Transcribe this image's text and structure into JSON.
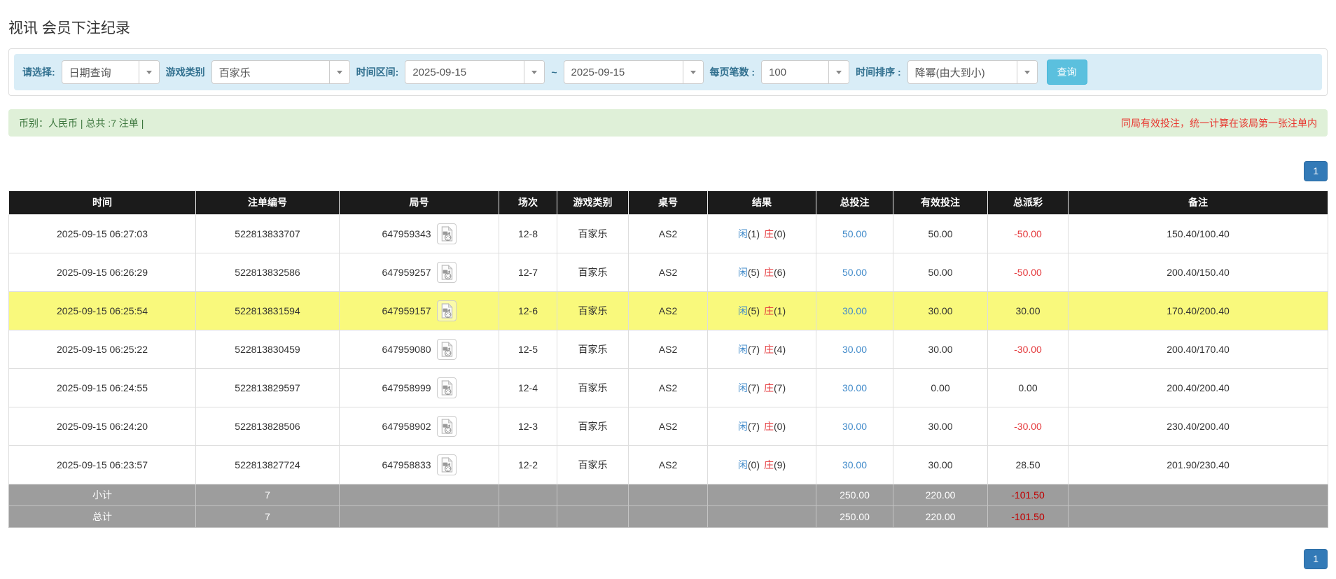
{
  "page": {
    "title": "视讯 会员下注纪录"
  },
  "colors": {
    "filter_bar_bg": "#d9edf7",
    "filter_label_blue": "#31708f",
    "summary_bg": "#dff0d8",
    "summary_green": "#3c763d",
    "notice_red": "#e8352e",
    "link_blue": "#428bca",
    "player_blue": "#428bca",
    "banker_red": "#e4393c",
    "negative_red": "#e4393c",
    "highlight_yellow": "#f9f97c",
    "table_header_bg": "#1b1b1b",
    "subtotal_bg": "#9d9d9d",
    "search_button_bg": "#5bc0de",
    "pagination_bg": "#337ab7"
  },
  "filters": {
    "mode_label": "请选择:",
    "mode_value": "日期查询",
    "game_label": "游戏类别",
    "game_value": "百家乐",
    "range_label": "时间区间:",
    "range_from": "2025-09-15",
    "range_separator": "~",
    "range_to": "2025-09-15",
    "per_page_label": "每页笔数 :",
    "per_page_value": "100",
    "sort_label": "时间排序 :",
    "sort_value": "降幂(由大到小)",
    "search_button": "查询"
  },
  "summary": {
    "left": "币别：人民币 | 总共 :7 注单 |",
    "right": "同局有效投注，统一计算在该局第一张注单内"
  },
  "pagination": {
    "page": "1"
  },
  "table": {
    "headers": [
      "时间",
      "注单编号",
      "局号",
      "场次",
      "游戏类别",
      "桌号",
      "结果",
      "总投注",
      "有效投注",
      "总派彩",
      "备注"
    ],
    "result_labels": {
      "player": "闲",
      "banker": "庄"
    },
    "rows": [
      {
        "time": "2025-09-15 06:27:03",
        "bet_id": "522813833707",
        "round_id": "647959343",
        "session": "12-8",
        "game": "百家乐",
        "table_id": "AS2",
        "player": "1",
        "banker": "0",
        "total_bet": "50.00",
        "valid_bet": "50.00",
        "payout": "-50.00",
        "remark": "150.40/100.40",
        "highlighted": false
      },
      {
        "time": "2025-09-15 06:26:29",
        "bet_id": "522813832586",
        "round_id": "647959257",
        "session": "12-7",
        "game": "百家乐",
        "table_id": "AS2",
        "player": "5",
        "banker": "6",
        "total_bet": "50.00",
        "valid_bet": "50.00",
        "payout": "-50.00",
        "remark": "200.40/150.40",
        "highlighted": false
      },
      {
        "time": "2025-09-15 06:25:54",
        "bet_id": "522813831594",
        "round_id": "647959157",
        "session": "12-6",
        "game": "百家乐",
        "table_id": "AS2",
        "player": "5",
        "banker": "1",
        "total_bet": "30.00",
        "valid_bet": "30.00",
        "payout": "30.00",
        "remark": "170.40/200.40",
        "highlighted": true
      },
      {
        "time": "2025-09-15 06:25:22",
        "bet_id": "522813830459",
        "round_id": "647959080",
        "session": "12-5",
        "game": "百家乐",
        "table_id": "AS2",
        "player": "7",
        "banker": "4",
        "total_bet": "30.00",
        "valid_bet": "30.00",
        "payout": "-30.00",
        "remark": "200.40/170.40",
        "highlighted": false
      },
      {
        "time": "2025-09-15 06:24:55",
        "bet_id": "522813829597",
        "round_id": "647958999",
        "session": "12-4",
        "game": "百家乐",
        "table_id": "AS2",
        "player": "7",
        "banker": "7",
        "total_bet": "30.00",
        "valid_bet": "0.00",
        "payout": "0.00",
        "remark": "200.40/200.40",
        "highlighted": false
      },
      {
        "time": "2025-09-15 06:24:20",
        "bet_id": "522813828506",
        "round_id": "647958902",
        "session": "12-3",
        "game": "百家乐",
        "table_id": "AS2",
        "player": "7",
        "banker": "0",
        "total_bet": "30.00",
        "valid_bet": "30.00",
        "payout": "-30.00",
        "remark": "230.40/200.40",
        "highlighted": false
      },
      {
        "time": "2025-09-15 06:23:57",
        "bet_id": "522813827724",
        "round_id": "647958833",
        "session": "12-2",
        "game": "百家乐",
        "table_id": "AS2",
        "player": "0",
        "banker": "9",
        "total_bet": "30.00",
        "valid_bet": "30.00",
        "payout": "28.50",
        "remark": "201.90/230.40",
        "highlighted": false
      }
    ],
    "subtotal": {
      "label": "小计",
      "count": "7",
      "total_bet": "250.00",
      "valid_bet": "220.00",
      "payout": "-101.50"
    },
    "total": {
      "label": "总计",
      "count": "7",
      "total_bet": "250.00",
      "valid_bet": "220.00",
      "payout": "-101.50"
    }
  }
}
